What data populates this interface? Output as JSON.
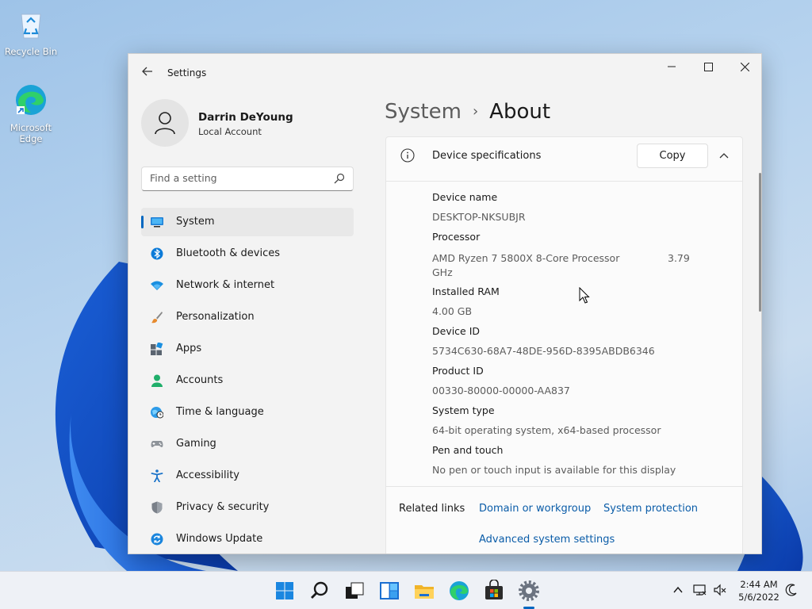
{
  "desktop": {
    "icons": [
      {
        "label": "Recycle Bin",
        "icon": "recycle-bin-icon"
      },
      {
        "label": "Microsoft Edge",
        "icon": "edge-icon"
      }
    ]
  },
  "window": {
    "title": "Settings",
    "controls": {
      "minimize": "minimize-icon",
      "maximize": "maximize-icon",
      "close": "close-icon"
    }
  },
  "user": {
    "name": "Darrin DeYoung",
    "account_type": "Local Account"
  },
  "search": {
    "placeholder": "Find a setting"
  },
  "nav": {
    "items": [
      {
        "label": "System",
        "icon": "system-icon",
        "active": true
      },
      {
        "label": "Bluetooth & devices",
        "icon": "bluetooth-icon"
      },
      {
        "label": "Network & internet",
        "icon": "wifi-icon"
      },
      {
        "label": "Personalization",
        "icon": "brush-icon"
      },
      {
        "label": "Apps",
        "icon": "apps-icon"
      },
      {
        "label": "Accounts",
        "icon": "person-icon"
      },
      {
        "label": "Time & language",
        "icon": "globe-icon"
      },
      {
        "label": "Gaming",
        "icon": "gamepad-icon"
      },
      {
        "label": "Accessibility",
        "icon": "accessibility-icon"
      },
      {
        "label": "Privacy & security",
        "icon": "shield-icon"
      },
      {
        "label": "Windows Update",
        "icon": "update-icon"
      }
    ]
  },
  "breadcrumb": {
    "parent": "System",
    "separator": "›",
    "current": "About"
  },
  "device_specs": {
    "title": "Device specifications",
    "copy_label": "Copy",
    "specs": [
      {
        "label": "Device name",
        "value": "DESKTOP-NKSUBJR"
      },
      {
        "label": "Processor",
        "value": "AMD Ryzen 7 5800X 8-Core Processor GHz",
        "value_extra": "3.79"
      },
      {
        "label": "Installed RAM",
        "value": "4.00 GB"
      },
      {
        "label": "Device ID",
        "value": "5734C630-68A7-48DE-956D-8395ABDB6346"
      },
      {
        "label": "Product ID",
        "value": "00330-80000-00000-AA837"
      },
      {
        "label": "System type",
        "value": "64-bit operating system, x64-based processor"
      },
      {
        "label": "Pen and touch",
        "value": "No pen or touch input is available for this display"
      }
    ]
  },
  "related_links": {
    "label": "Related links",
    "links": [
      "Domain or workgroup",
      "System protection",
      "Advanced system settings"
    ]
  },
  "taskbar": {
    "apps": [
      "start-icon",
      "search-icon",
      "task-view-icon",
      "widgets-icon",
      "file-explorer-icon",
      "edge-icon",
      "store-icon",
      "settings-icon"
    ],
    "tray": [
      "chevron-up-icon",
      "network-icon",
      "volume-muted-icon",
      "notification-icon"
    ],
    "time": "2:44 AM",
    "date": "5/6/2022"
  },
  "colors": {
    "accent": "#0067c0",
    "link": "#0a5ca8"
  }
}
